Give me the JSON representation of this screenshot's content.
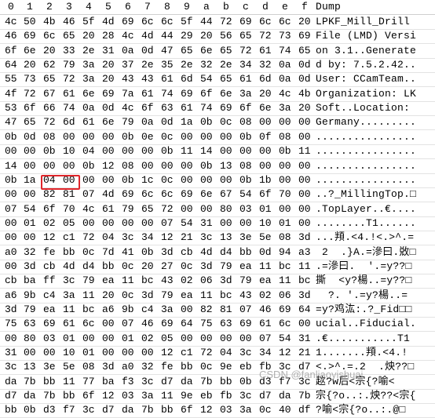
{
  "header": {
    "columns": [
      "0",
      "1",
      "2",
      "3",
      "4",
      "5",
      "6",
      "7",
      "8",
      "9",
      "a",
      "b",
      "c",
      "d",
      "e",
      "f"
    ],
    "dump_label": "Dump"
  },
  "rows": [
    {
      "bytes": [
        "4c",
        "50",
        "4b",
        "46",
        "5f",
        "4d",
        "69",
        "6c",
        "6c",
        "5f",
        "44",
        "72",
        "69",
        "6c",
        "6c",
        "20"
      ],
      "dump": "LPKF_Mill_Drill "
    },
    {
      "bytes": [
        "46",
        "69",
        "6c",
        "65",
        "20",
        "28",
        "4c",
        "4d",
        "44",
        "29",
        "20",
        "56",
        "65",
        "72",
        "73",
        "69"
      ],
      "dump": "File (LMD) Versi"
    },
    {
      "bytes": [
        "6f",
        "6e",
        "20",
        "33",
        "2e",
        "31",
        "0a",
        "0d",
        "47",
        "65",
        "6e",
        "65",
        "72",
        "61",
        "74",
        "65"
      ],
      "dump": "on 3.1..Generate"
    },
    {
      "bytes": [
        "64",
        "20",
        "62",
        "79",
        "3a",
        "20",
        "37",
        "2e",
        "35",
        "2e",
        "32",
        "2e",
        "34",
        "32",
        "0a",
        "0d"
      ],
      "dump": "d by: 7.5.2.42.."
    },
    {
      "bytes": [
        "55",
        "73",
        "65",
        "72",
        "3a",
        "20",
        "43",
        "43",
        "61",
        "6d",
        "54",
        "65",
        "61",
        "6d",
        "0a",
        "0d"
      ],
      "dump": "User: CCamTeam.."
    },
    {
      "bytes": [
        "4f",
        "72",
        "67",
        "61",
        "6e",
        "69",
        "7a",
        "61",
        "74",
        "69",
        "6f",
        "6e",
        "3a",
        "20",
        "4c",
        "4b"
      ],
      "dump": "Organization: LK"
    },
    {
      "bytes": [
        "53",
        "6f",
        "66",
        "74",
        "0a",
        "0d",
        "4c",
        "6f",
        "63",
        "61",
        "74",
        "69",
        "6f",
        "6e",
        "3a",
        "20"
      ],
      "dump": "Soft..Location: "
    },
    {
      "bytes": [
        "47",
        "65",
        "72",
        "6d",
        "61",
        "6e",
        "79",
        "0a",
        "0d",
        "1a",
        "0b",
        "0c",
        "08",
        "00",
        "00",
        "00"
      ],
      "dump": "Germany........."
    },
    {
      "bytes": [
        "0b",
        "0d",
        "08",
        "00",
        "00",
        "00",
        "0b",
        "0e",
        "0c",
        "00",
        "00",
        "00",
        "0b",
        "0f",
        "08",
        "00"
      ],
      "dump": "................"
    },
    {
      "bytes": [
        "00",
        "00",
        "0b",
        "10",
        "04",
        "00",
        "00",
        "00",
        "0b",
        "11",
        "14",
        "00",
        "00",
        "00",
        "0b",
        "11"
      ],
      "dump": "................"
    },
    {
      "bytes": [
        "14",
        "00",
        "00",
        "00",
        "0b",
        "12",
        "08",
        "00",
        "00",
        "00",
        "0b",
        "13",
        "08",
        "00",
        "00",
        "00"
      ],
      "dump": "................"
    },
    {
      "bytes": [
        "0b",
        "1a",
        "04",
        "00",
        "00",
        "00",
        "0b",
        "1c",
        "0c",
        "00",
        "00",
        "00",
        "0b",
        "1b",
        "00",
        "00"
      ],
      "dump": "................"
    },
    {
      "bytes": [
        "00",
        "00",
        "82",
        "81",
        "07",
        "4d",
        "69",
        "6c",
        "6c",
        "69",
        "6e",
        "67",
        "54",
        "6f",
        "70",
        "00"
      ],
      "dump": "..?_MillingTop.□"
    },
    {
      "bytes": [
        "07",
        "54",
        "6f",
        "70",
        "4c",
        "61",
        "79",
        "65",
        "72",
        "00",
        "00",
        "80",
        "03",
        "01",
        "00",
        "00"
      ],
      "dump": ".TopLayer..€...."
    },
    {
      "bytes": [
        "00",
        "01",
        "02",
        "05",
        "00",
        "00",
        "00",
        "00",
        "07",
        "54",
        "31",
        "00",
        "00",
        "10",
        "01",
        "00"
      ],
      "dump": "........T1......"
    },
    {
      "bytes": [
        "00",
        "00",
        "12",
        "c1",
        "72",
        "04",
        "3c",
        "34",
        "12",
        "21",
        "3c",
        "13",
        "3e",
        "5e",
        "08",
        "3d"
      ],
      "dump": "...頖.<4.!<.>^.="
    },
    {
      "bytes": [
        "a0",
        "32",
        "fe",
        "bb",
        "0c",
        "7d",
        "41",
        "0b",
        "3d",
        "cb",
        "4d",
        "d4",
        "bb",
        "0d",
        "94",
        "a3"
      ],
      "dump": " 2  .}A.=滲曰.敚□"
    },
    {
      "bytes": [
        "00",
        "3d",
        "cb",
        "4d",
        "d4",
        "bb",
        "0c",
        "20",
        "27",
        "0c",
        "3d",
        "79",
        "ea",
        "11",
        "bc",
        "11"
      ],
      "dump": ".=滲曰.  '.=y??□"
    },
    {
      "bytes": [
        "cb",
        "ba",
        "ff",
        "3c",
        "79",
        "ea",
        "11",
        "bc",
        "43",
        "02",
        "06",
        "3d",
        "79",
        "ea",
        "11",
        "bc"
      ],
      "dump": "撕  <y?楊..=y??□"
    },
    {
      "bytes": [
        "a6",
        "9b",
        "c4",
        "3a",
        "11",
        "20",
        "0c",
        "3d",
        "79",
        "ea",
        "11",
        "bc",
        "43",
        "02",
        "06",
        "3d"
      ],
      "dump": "  ?. '.=y?楊..="
    },
    {
      "bytes": [
        "3d",
        "79",
        "ea",
        "11",
        "bc",
        "a6",
        "9b",
        "c4",
        "3a",
        "00",
        "82",
        "81",
        "07",
        "46",
        "69",
        "64"
      ],
      "dump": "=y?鸡汯:.?_Fid□□"
    },
    {
      "bytes": [
        "75",
        "63",
        "69",
        "61",
        "6c",
        "00",
        "07",
        "46",
        "69",
        "64",
        "75",
        "63",
        "69",
        "61",
        "6c",
        "00"
      ],
      "dump": "ucial..Fiducial."
    },
    {
      "bytes": [
        "00",
        "80",
        "03",
        "01",
        "00",
        "00",
        "01",
        "02",
        "05",
        "00",
        "00",
        "00",
        "00",
        "07",
        "54",
        "31"
      ],
      "dump": ".€...........T1"
    },
    {
      "bytes": [
        "31",
        "00",
        "00",
        "10",
        "01",
        "00",
        "00",
        "00",
        "12",
        "c1",
        "72",
        "04",
        "3c",
        "34",
        "12",
        "21"
      ],
      "dump": "1.......頖.<4.!"
    },
    {
      "bytes": [
        "3c",
        "13",
        "3e",
        "5e",
        "08",
        "3d",
        "a0",
        "32",
        "fe",
        "bb",
        "0c",
        "9e",
        "eb",
        "fb",
        "3c",
        "d7"
      ],
      "dump": "<.>^.=.2  .炴??□"
    },
    {
      "bytes": [
        "da",
        "7b",
        "bb",
        "11",
        "77",
        "ba",
        "f3",
        "3c",
        "d7",
        "da",
        "7b",
        "bb",
        "0b",
        "d3",
        "f7",
        "3c"
      ],
      "dump": "趑?w后<宗{?喻<"
    },
    {
      "bytes": [
        "d7",
        "da",
        "7b",
        "bb",
        "6f",
        "12",
        "03",
        "3a",
        "11",
        "9e",
        "eb",
        "fb",
        "3c",
        "d7",
        "da",
        "7b"
      ],
      "dump": "宗{?o..:.炴??<宗{"
    },
    {
      "bytes": [
        "bb",
        "0b",
        "d3",
        "f7",
        "3c",
        "d7",
        "da",
        "7b",
        "bb",
        "6f",
        "12",
        "03",
        "3a",
        "0c",
        "40",
        "df"
      ],
      "dump": "?喻<宗{?o..:.@□"
    }
  ],
  "watermark": "CSDN @fanliaoyishuai"
}
